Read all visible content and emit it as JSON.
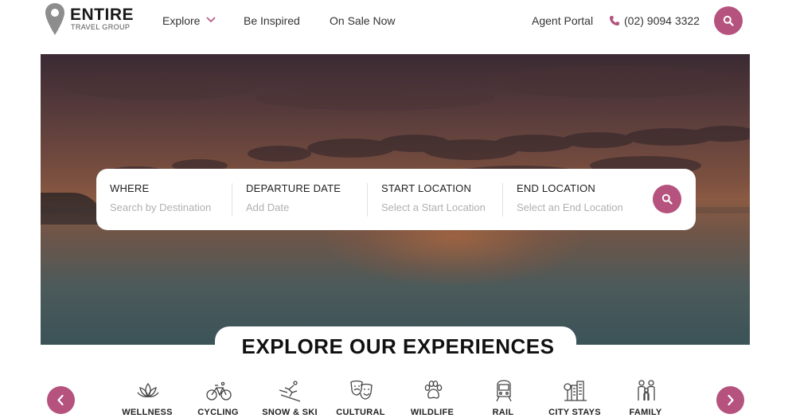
{
  "brand": {
    "name": "ENTIRE",
    "tagline": "TRAVEL GROUP",
    "accent_color": "#b5527e",
    "pin_color": "#8d8d8d"
  },
  "nav": {
    "items": [
      {
        "label": "Explore",
        "has_dropdown": true
      },
      {
        "label": "Be Inspired"
      },
      {
        "label": "On Sale Now"
      }
    ],
    "agent_portal": "Agent Portal",
    "phone": "(02) 9094 3322"
  },
  "search": {
    "fields": [
      {
        "label": "WHERE",
        "placeholder": "Search by Destination"
      },
      {
        "label": "DEPARTURE DATE",
        "placeholder": "Add Date"
      },
      {
        "label": "START LOCATION",
        "placeholder": "Select a Start Location"
      },
      {
        "label": "END LOCATION",
        "placeholder": "Select an End Location"
      }
    ]
  },
  "experiences": {
    "title": "EXPLORE OUR EXPERIENCES",
    "items": [
      {
        "label": "WELLNESS",
        "icon": "lotus-icon"
      },
      {
        "label": "CYCLING",
        "icon": "bicycle-icon"
      },
      {
        "label": "SNOW & SKI",
        "icon": "skier-icon"
      },
      {
        "label": "CULTURAL",
        "icon": "theatre-masks-icon"
      },
      {
        "label": "WILDLIFE",
        "icon": "paw-icon"
      },
      {
        "label": "RAIL",
        "icon": "train-icon"
      },
      {
        "label": "CITY STAYS",
        "icon": "city-icon"
      },
      {
        "label": "FAMILY",
        "icon": "family-icon"
      }
    ]
  }
}
